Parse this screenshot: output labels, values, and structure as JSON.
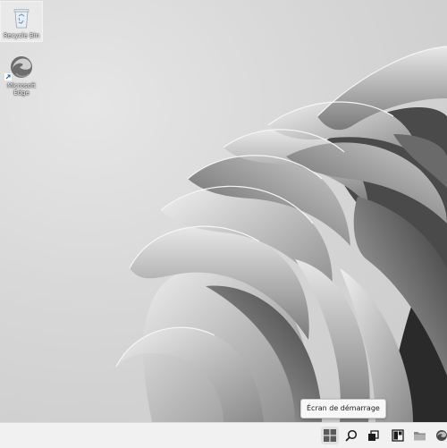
{
  "desktop": {
    "icons": [
      {
        "label": "Recycle Bin",
        "icon": "recycle-bin-icon"
      },
      {
        "label": "Microsoft Edge",
        "icon": "edge-icon"
      }
    ],
    "wallpaper": "windows-11-bloom-grey"
  },
  "taskbar": {
    "buttons": [
      {
        "name": "start",
        "icon": "windows-start-icon"
      },
      {
        "name": "search",
        "icon": "search-icon"
      },
      {
        "name": "task-view",
        "icon": "task-view-icon"
      },
      {
        "name": "widgets",
        "icon": "widgets-icon"
      },
      {
        "name": "file-explorer",
        "icon": "folder-icon"
      },
      {
        "name": "edge",
        "icon": "edge-icon"
      }
    ],
    "tooltip": "Écran de démarrage"
  },
  "colors": {
    "taskbar": "#f1f1f1",
    "wallpaper_light": "#e6e6e6",
    "wallpaper_dark": "#2a2a2a"
  }
}
